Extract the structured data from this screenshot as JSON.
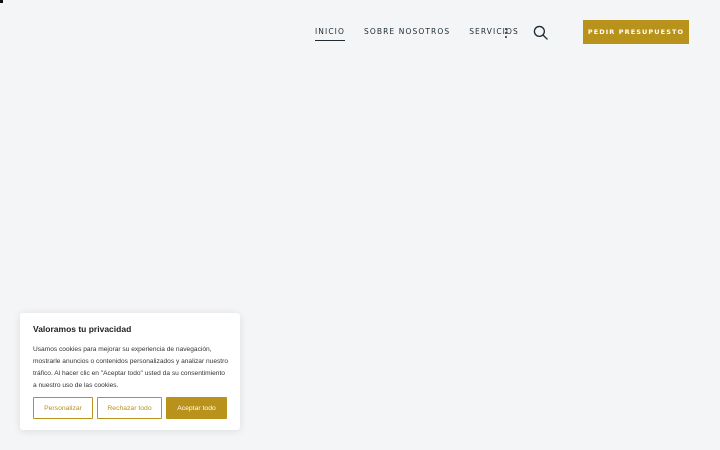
{
  "header": {
    "nav": [
      {
        "label": "INICIO",
        "active": true
      },
      {
        "label": "SOBRE NOSOTROS",
        "active": false
      },
      {
        "label": "SERVICIOS",
        "active": false
      }
    ],
    "more_icon": "vertical-dots-icon",
    "search_icon": "search-icon",
    "cta_label": "PEDIR PRESUPUESTO"
  },
  "cookie_banner": {
    "title": "Valoramos tu privacidad",
    "text": "Usamos cookies para mejorar su experiencia de navegación, mostrarle anuncios o contenidos personalizados y analizar nuestro tráfico. Al hacer clic en \"Aceptar todo\" usted da su consentimiento a nuestro uso de las cookies.",
    "buttons": {
      "customize": "Personalizar",
      "reject": "Rechazar todo",
      "accept": "Aceptar todo"
    }
  },
  "colors": {
    "accent": "#b8921a",
    "background": "#f4f5f7",
    "nav_text": "#1b2a33"
  }
}
